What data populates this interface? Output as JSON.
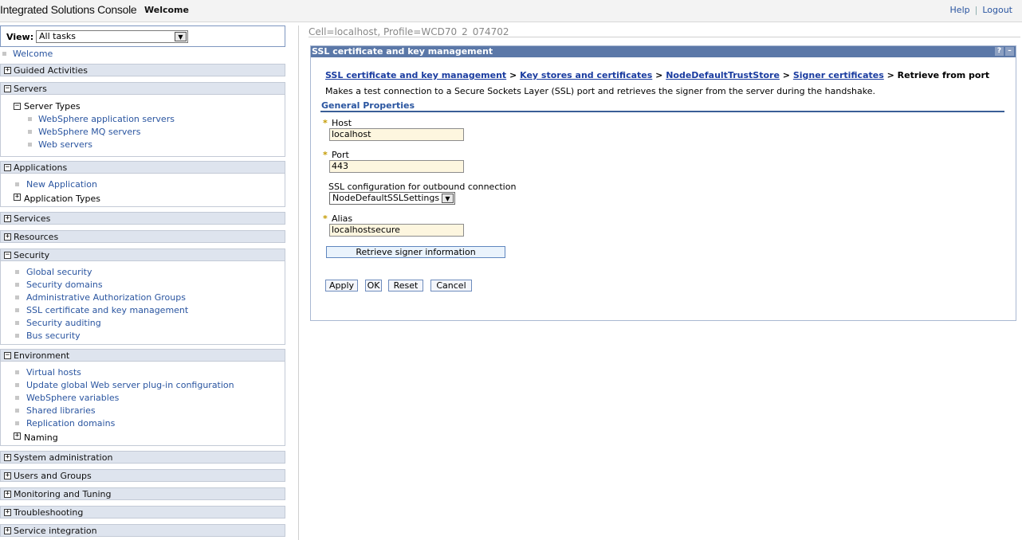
{
  "banner": {
    "brand": "Integrated Solutions Console",
    "welcome": "Welcome",
    "help": "Help",
    "logout": "Logout",
    "separator": "|"
  },
  "nav": {
    "view_label": "View:",
    "view_value": "All tasks",
    "welcome_link": "Welcome",
    "groups": {
      "guided": "Guided Activities",
      "servers": "Servers",
      "applications": "Applications",
      "services": "Services",
      "resources": "Resources",
      "security": "Security",
      "environment": "Environment",
      "sysadmin": "System administration",
      "users": "Users and Groups",
      "monitoring": "Monitoring and Tuning",
      "troubleshooting": "Troubleshooting",
      "service_integration": "Service integration"
    },
    "servers": {
      "server_types": "Server Types",
      "items": [
        "WebSphere application servers",
        "WebSphere MQ servers",
        "Web servers"
      ]
    },
    "applications": {
      "new_application": "New Application",
      "application_types": "Application Types"
    },
    "security": {
      "items": [
        "Global security",
        "Security domains",
        "Administrative Authorization Groups",
        "SSL certificate and key management",
        "Security auditing",
        "Bus security"
      ]
    },
    "environment": {
      "items": [
        "Virtual hosts",
        "Update global Web server plug-in configuration",
        "WebSphere variables",
        "Shared libraries",
        "Replication domains"
      ],
      "naming": "Naming"
    },
    "plus": "+",
    "minus": "−"
  },
  "content": {
    "cell_line": "Cell=localhost, Profile=WCD70_2_074702",
    "panel_title": "SSL certificate and key management",
    "help_btn": "?",
    "min_btn": "–",
    "breadcrumb": {
      "items": [
        "SSL certificate and key management",
        "Key stores and certificates",
        "NodeDefaultTrustStore",
        "Signer certificates"
      ],
      "separator": ">",
      "current": "Retrieve from port"
    },
    "description": "Makes a test connection to a Secure Sockets Layer (SSL) port and retrieves the signer from the server during the handshake.",
    "general_properties": "General Properties",
    "required_mark": "*",
    "host": {
      "label": "Host",
      "value": "localhost"
    },
    "port": {
      "label": "Port",
      "value": "443"
    },
    "ssl_config": {
      "label": "SSL configuration for outbound connection",
      "value": "NodeDefaultSSLSettings"
    },
    "alias": {
      "label": "Alias",
      "value": "localhostsecure"
    },
    "retrieve_button": "Retrieve signer information",
    "buttons": {
      "apply": "Apply",
      "ok": "OK",
      "reset": "Reset",
      "cancel": "Cancel"
    },
    "dropdown_arrow": "▼"
  }
}
